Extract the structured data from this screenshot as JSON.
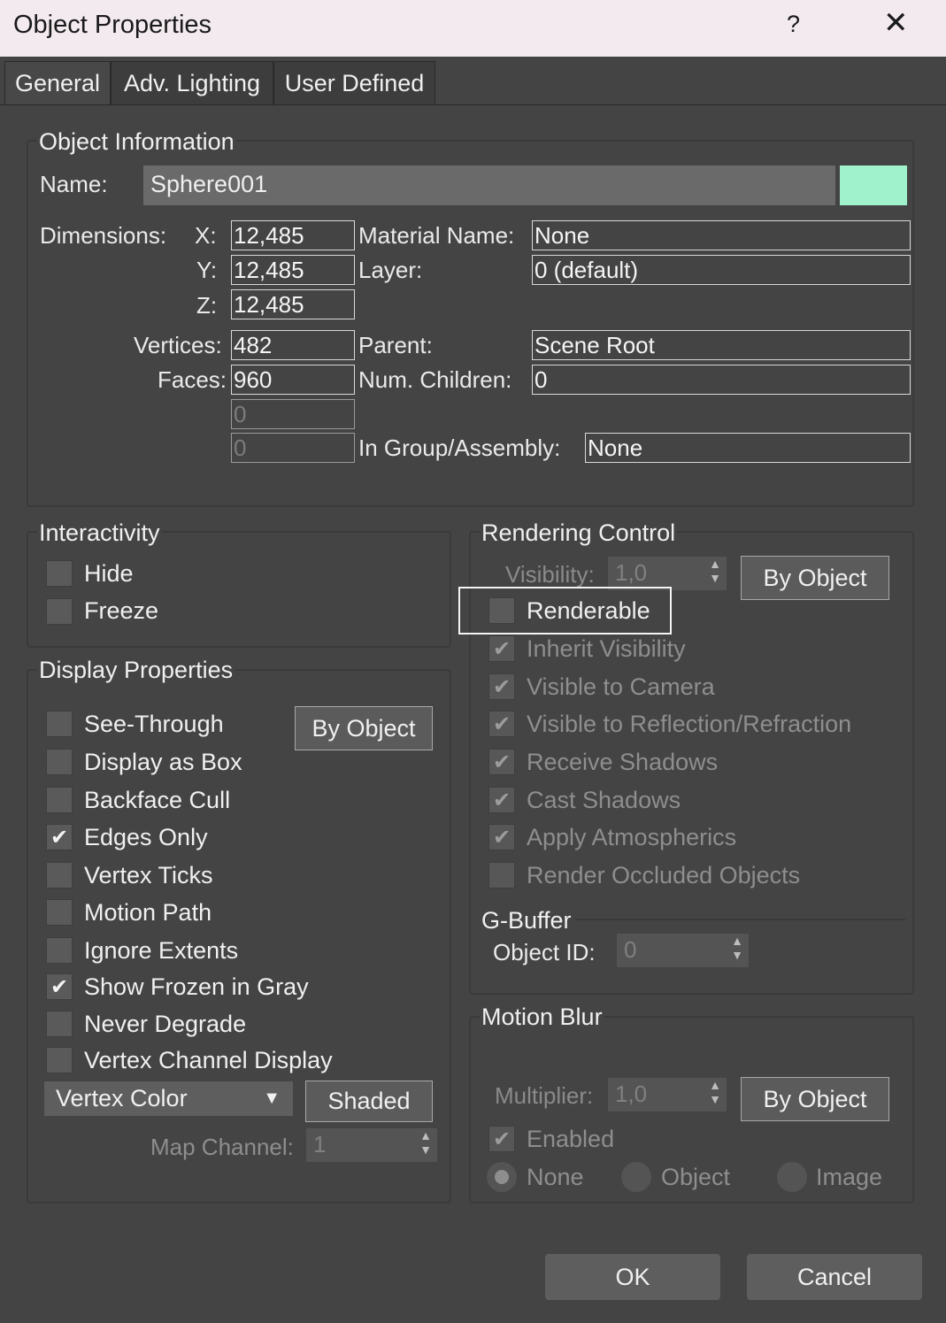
{
  "window": {
    "title": "Object Properties",
    "help": "?",
    "close": "✕"
  },
  "tabs": [
    "General",
    "Adv. Lighting",
    "User Defined"
  ],
  "object_info": {
    "title": "Object Information",
    "name_label": "Name:",
    "name_value": "Sphere001",
    "color": "#9ff2cc",
    "dimensions_label": "Dimensions:",
    "x_label": "X:",
    "x_value": "12,485",
    "y_label": "Y:",
    "y_value": "12,485",
    "z_label": "Z:",
    "z_value": "12,485",
    "vertices_label": "Vertices:",
    "vertices_value": "482",
    "faces_label": "Faces:",
    "faces_value": "960",
    "extra1_value": "0",
    "extra2_value": "0",
    "material_label": "Material Name:",
    "material_value": "None",
    "layer_label": "Layer:",
    "layer_value": "0 (default)",
    "parent_label": "Parent:",
    "parent_value": "Scene Root",
    "children_label": "Num. Children:",
    "children_value": "0",
    "group_label": "In Group/Assembly:",
    "group_value": "None"
  },
  "interactivity": {
    "title": "Interactivity",
    "items": [
      {
        "label": "Hide",
        "checked": false
      },
      {
        "label": "Freeze",
        "checked": false
      }
    ]
  },
  "display_props": {
    "title": "Display Properties",
    "by_object": "By Object",
    "items": [
      {
        "label": "See-Through",
        "checked": false
      },
      {
        "label": "Display as Box",
        "checked": false
      },
      {
        "label": "Backface Cull",
        "checked": false
      },
      {
        "label": "Edges Only",
        "checked": true
      },
      {
        "label": "Vertex Ticks",
        "checked": false
      },
      {
        "label": "Motion Path",
        "checked": false
      },
      {
        "label": "Ignore Extents",
        "checked": false
      },
      {
        "label": "Show Frozen in Gray",
        "checked": true
      },
      {
        "label": "Never Degrade",
        "checked": false
      },
      {
        "label": "Vertex Channel Display",
        "checked": false
      }
    ],
    "vertex_color": "Vertex Color",
    "shaded": "Shaded",
    "map_channel_label": "Map Channel:",
    "map_channel_value": "1"
  },
  "rendering": {
    "title": "Rendering Control",
    "visibility_label": "Visibility:",
    "visibility_value": "1,0",
    "by_object": "By Object",
    "items": [
      {
        "label": "Renderable",
        "checked": false,
        "enabled": true
      },
      {
        "label": "Inherit Visibility",
        "checked": true,
        "enabled": false
      },
      {
        "label": "Visible to Camera",
        "checked": true,
        "enabled": false
      },
      {
        "label": "Visible to Reflection/Refraction",
        "checked": true,
        "enabled": false
      },
      {
        "label": "Receive Shadows",
        "checked": true,
        "enabled": false
      },
      {
        "label": "Cast Shadows",
        "checked": true,
        "enabled": false
      },
      {
        "label": "Apply Atmospherics",
        "checked": true,
        "enabled": false
      },
      {
        "label": "Render Occluded Objects",
        "checked": false,
        "enabled": false
      }
    ],
    "gbuffer_title": "G-Buffer",
    "object_id_label": "Object ID:",
    "object_id_value": "0"
  },
  "motion_blur": {
    "title": "Motion Blur",
    "multiplier_label": "Multiplier:",
    "multiplier_value": "1,0",
    "by_object": "By Object",
    "enabled_label": "Enabled",
    "radio": [
      {
        "label": "None",
        "selected": true
      },
      {
        "label": "Object",
        "selected": false
      },
      {
        "label": "Image",
        "selected": false
      }
    ]
  },
  "buttons": {
    "ok": "OK",
    "cancel": "Cancel"
  }
}
